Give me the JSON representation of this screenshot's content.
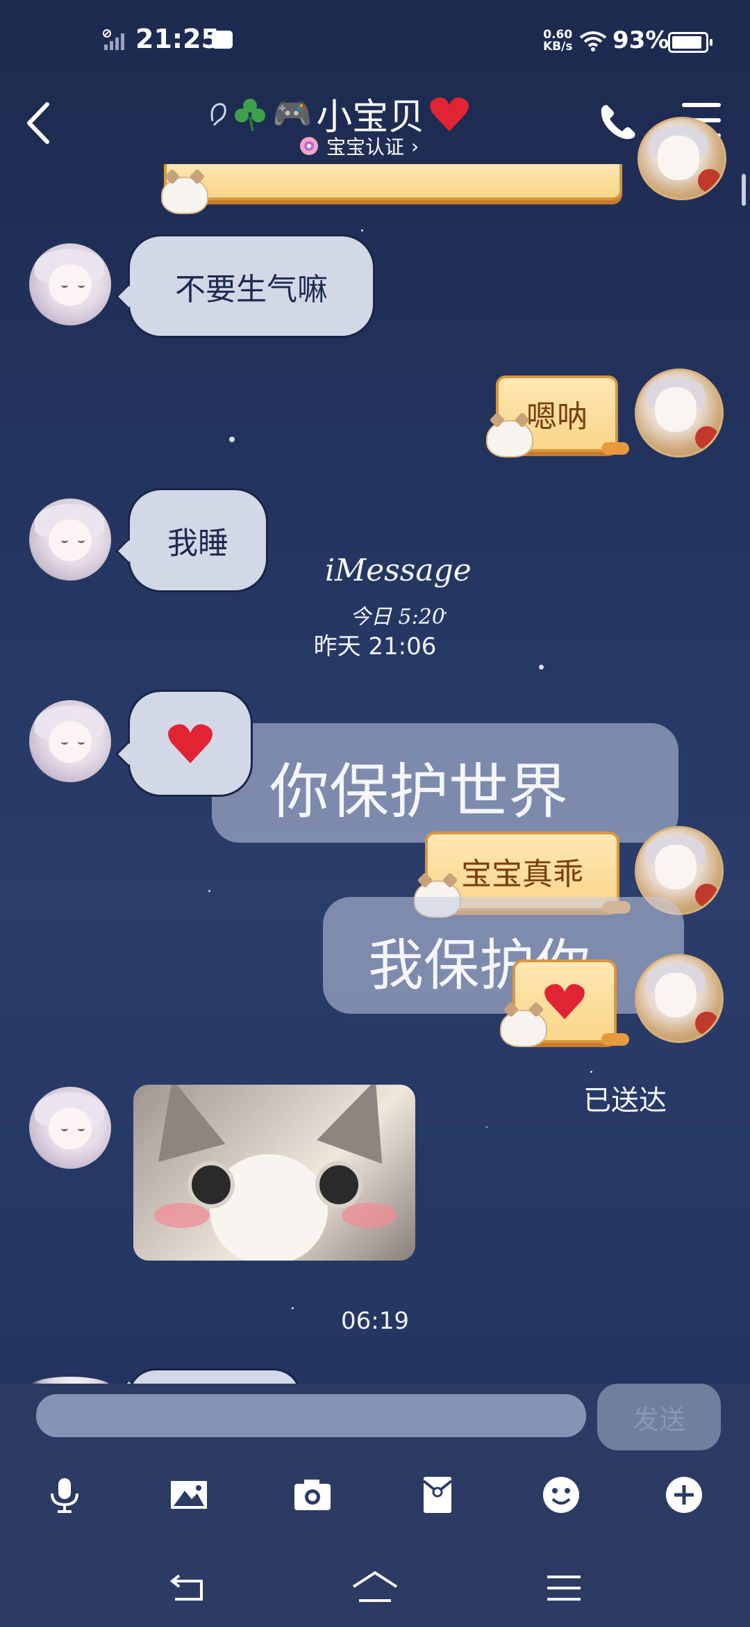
{
  "status_bar": {
    "time": "21:25",
    "net_speed": "0.60",
    "net_unit": "KB/s",
    "battery": "93%"
  },
  "header": {
    "title": "小宝贝",
    "title_emoji": "🎮",
    "subtitle": "宝宝认证",
    "subtitle_arrow": "›"
  },
  "messages": {
    "m1": "不要生气嘛",
    "m2": "嗯呐",
    "m3": "我睡",
    "m4": "宝宝真乖"
  },
  "timestamps": {
    "t1": "昨天 21:06",
    "t2": "06:19"
  },
  "decor": {
    "imessage": "iMessage",
    "imessage_time": "今日 5:20",
    "line1": "你保护世界",
    "line2": "我保护你",
    "delivered": "已送达"
  },
  "composer": {
    "send_label": "发送"
  },
  "toolbar": {
    "icons": [
      "microphone-icon",
      "image-icon",
      "camera-icon",
      "red-packet-icon",
      "emoji-icon",
      "plus-icon"
    ]
  },
  "colors": {
    "bg": "#23345f",
    "bubble_in": "#d3d8e6",
    "bubble_out": "#f9d68a",
    "heart": "#e02434"
  }
}
